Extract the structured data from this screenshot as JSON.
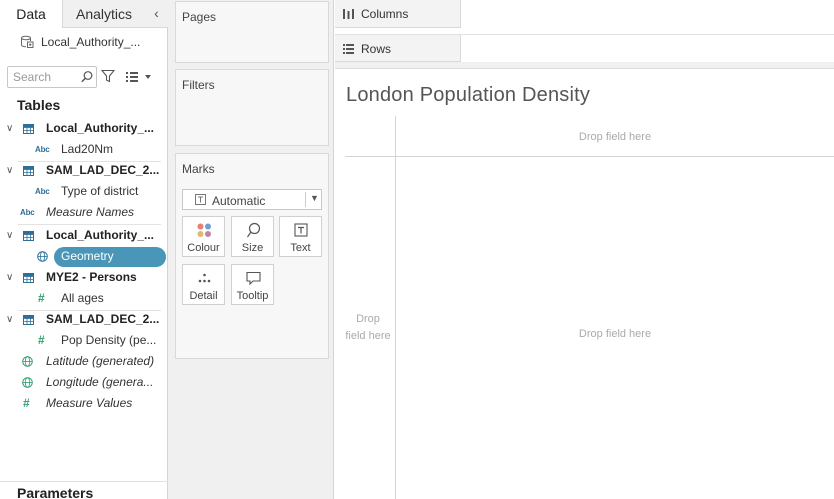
{
  "data_pane": {
    "tabs": [
      {
        "label": "Data",
        "active": true
      },
      {
        "label": "Analytics",
        "active": false
      }
    ],
    "collapse_glyph": "‹",
    "data_source": "Local_Authority_...",
    "search": {
      "placeholder": "Search"
    },
    "tables_title": "Tables",
    "fields": [
      {
        "kind": "table",
        "label": "Local_Authority_..."
      },
      {
        "kind": "dimension",
        "type": "Abc",
        "label": "Lad20Nm"
      },
      {
        "kind": "table",
        "label": "SAM_LAD_DEC_2..."
      },
      {
        "kind": "dimension",
        "type": "Abc",
        "label": "Type of district"
      },
      {
        "kind": "dimension",
        "type": "Abc",
        "label": "Measure Names",
        "italic": true
      },
      {
        "kind": "table",
        "label": "Local_Authority_..."
      },
      {
        "kind": "dimension",
        "type": "geo",
        "label": "Geometry",
        "selected": true
      },
      {
        "kind": "table",
        "label": "MYE2 - Persons"
      },
      {
        "kind": "measure",
        "type": "#",
        "label": "All ages"
      },
      {
        "kind": "table",
        "label": "SAM_LAD_DEC_2..."
      },
      {
        "kind": "measure",
        "type": "#",
        "label": "Pop Density (pe..."
      },
      {
        "kind": "measure",
        "type": "geo",
        "label": "Latitude (generated)",
        "italic": true
      },
      {
        "kind": "measure",
        "type": "geo",
        "label": "Longitude (genera...",
        "italic": true
      },
      {
        "kind": "measure",
        "type": "#",
        "label": "Measure Values",
        "italic": true
      }
    ],
    "parameters_title": "Parameters"
  },
  "mid_pane": {
    "pages_title": "Pages",
    "filters_title": "Filters",
    "marks_title": "Marks",
    "mark_type": "Automatic",
    "mark_buttons": [
      {
        "label": "Colour",
        "icon": "colour-dots-icon"
      },
      {
        "label": "Size",
        "icon": "size-lasso-icon"
      },
      {
        "label": "Text",
        "icon": "text-box-icon"
      },
      {
        "label": "Detail",
        "icon": "detail-dots-icon"
      },
      {
        "label": "Tooltip",
        "icon": "tooltip-bubble-icon"
      }
    ]
  },
  "canvas": {
    "columns_label": "Columns",
    "rows_label": "Rows",
    "title": "London Population Density",
    "drop_columns": "Drop field here",
    "drop_rows": "Drop field here",
    "drop_main": "Drop field here"
  },
  "colors": {
    "selected_pill": "#4a96b8",
    "measure_green": "#2ea06e",
    "dimension_blue": "#2e6f99",
    "pane_bg": "#f0f0f0"
  }
}
